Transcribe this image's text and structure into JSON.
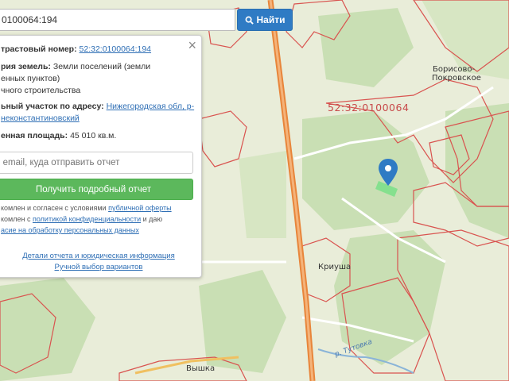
{
  "search": {
    "value": "0100064:194",
    "button_label": "Найти"
  },
  "panel": {
    "cadastral_label": "трастовый номер:",
    "cadastral_value": "52:32:0100064:194",
    "category_label": "рия земель:",
    "category_value_1": "Земли поселений (земли",
    "category_value_2": "енных пунктов)",
    "category_value_3": "чного строительства",
    "address_label": "ьный участок по адресу:",
    "address_value_1": "Нижегородская обл, р-",
    "address_value_2": "некoнстантиновский",
    "area_label": "енная площадь:",
    "area_value": "45 010 кв.м.",
    "email_placeholder": "u email, куда отправить отчет",
    "report_button": "Получить подробный отчет",
    "legal_1a": "комлен и согласен с условиями",
    "legal_1b": "публичной оферты",
    "legal_2a": "комлен с",
    "legal_2b": "политикой конфиденциальности",
    "legal_2c": "и даю",
    "legal_3": "асие на обработку персональных данных",
    "link_details": "Детали отчета и юридическая информация",
    "link_manual": "Ручной выбор вариантов"
  },
  "map": {
    "cadastral_block": "52:32:0100064",
    "places": {
      "borisovo_1": "Борисово-",
      "borisovo_2": "Покровское",
      "kriusha": "Криуша",
      "vyshka": "Вышка"
    },
    "river": "р. Тутовка",
    "colors": {
      "boundary": "#d9534f",
      "road": "#e8853a",
      "pin": "#2f7bc4",
      "parcel": "#7de08a"
    }
  }
}
